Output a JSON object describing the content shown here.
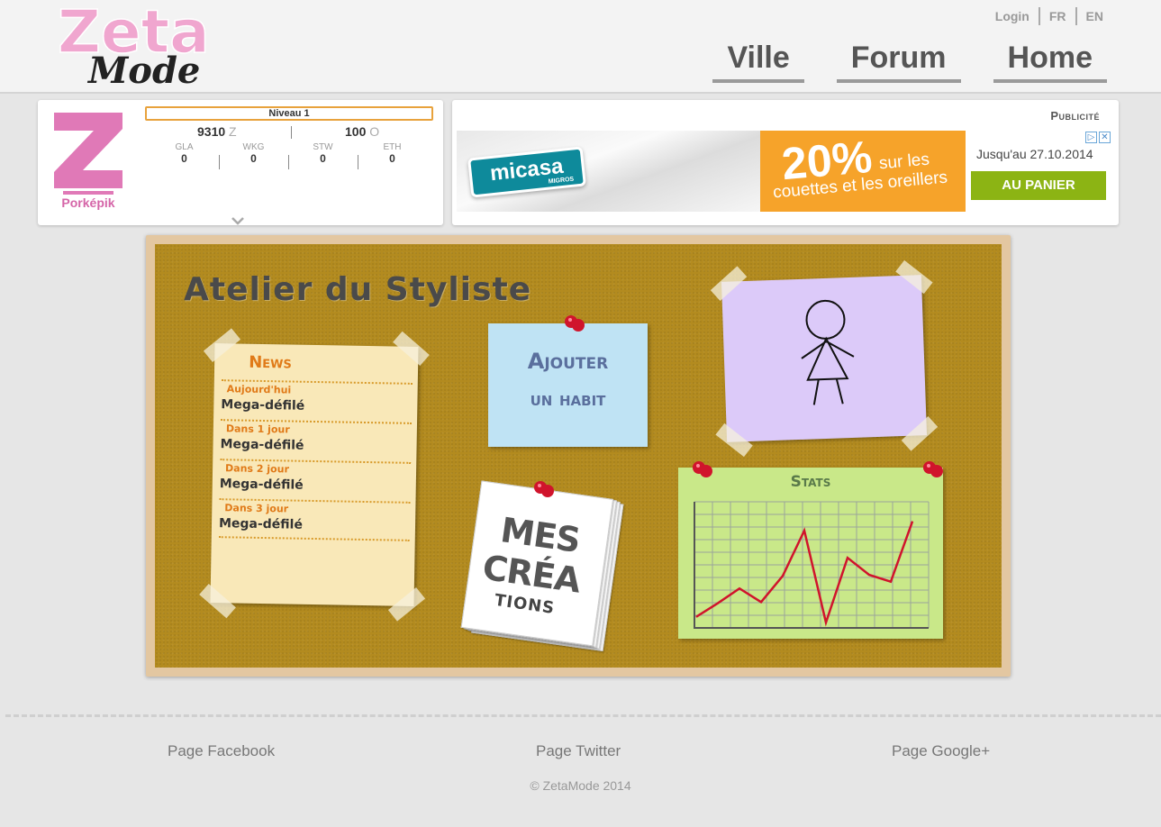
{
  "header": {
    "logo_line1": "Zeta",
    "logo_line2": "Mode",
    "top_links": [
      "Login",
      "FR",
      "EN"
    ],
    "nav": [
      "Ville",
      "Forum",
      "Home"
    ]
  },
  "profile": {
    "avatar_letter": "Z",
    "name": "Porképik",
    "level": "Niveau 1",
    "z_amount": "9310",
    "z_unit": "Z",
    "o_amount": "100",
    "o_unit": "O",
    "stats": [
      {
        "key": "GLA",
        "value": "0"
      },
      {
        "key": "WKG",
        "value": "0"
      },
      {
        "key": "STW",
        "value": "0"
      },
      {
        "key": "ETH",
        "value": "0"
      }
    ]
  },
  "ad": {
    "label": "Publicité",
    "brand": "micasa",
    "brand_sub": "MIGROS",
    "percent": "20%",
    "line1": "sur les",
    "line2": "couettes et les oreillers",
    "until": "Jusqu'au 27.10.2014",
    "button": "AU PANIER"
  },
  "board": {
    "title": "Atelier du Styliste",
    "news_title": "News",
    "news": [
      {
        "date": "Aujourd'hui",
        "name": "Mega-défilé"
      },
      {
        "date": "Dans 1 jour",
        "name": "Mega-défilé"
      },
      {
        "date": "Dans 2 jour",
        "name": "Mega-défilé"
      },
      {
        "date": "Dans 3 jour",
        "name": "Mega-défilé"
      }
    ],
    "add_line1": "Ajouter",
    "add_line2": "un habit",
    "mes_line1": "MES",
    "mes_line2": "CRÉA",
    "mes_line3": "TIONS",
    "stats_title": "Stats"
  },
  "chart_data": {
    "type": "line",
    "title": "Stats",
    "values": [
      0.05,
      0.17,
      0.3,
      0.18,
      0.41,
      0.81,
      0.0,
      0.57,
      0.42,
      0.36,
      0.89
    ],
    "ylim": [
      0,
      1
    ],
    "grid": true,
    "colors": {
      "line": "#d0142c"
    }
  },
  "footer": {
    "facebook": "Page Facebook",
    "twitter": "Page Twitter",
    "google": "Page Google+",
    "copyright": "© ZetaMode 2014"
  }
}
